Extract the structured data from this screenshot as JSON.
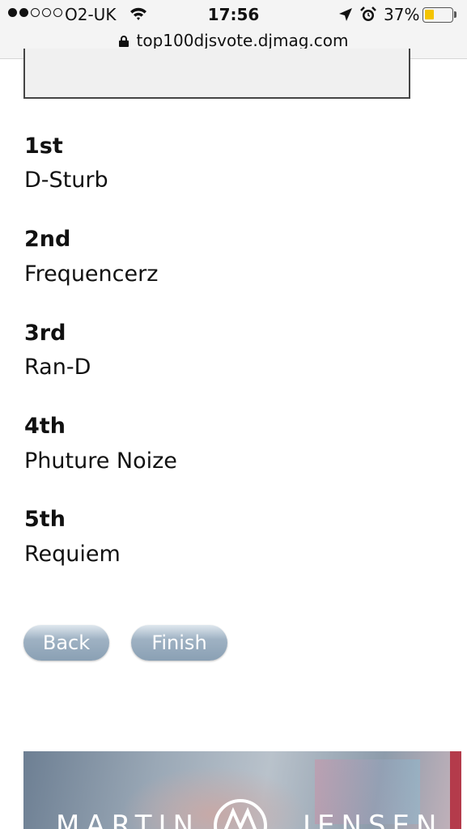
{
  "status_bar": {
    "carrier": "O2-UK",
    "time": "17:56",
    "battery_percent": "37%",
    "battery_level": 0.37,
    "signal_bars_filled": 2,
    "signal_bars_total": 5,
    "icons": [
      "wifi-icon",
      "location-arrow-icon",
      "alarm-icon",
      "battery-icon"
    ]
  },
  "url_bar": {
    "url": "top100djsvote.djmag.com",
    "icon": "lock-icon"
  },
  "votes": [
    {
      "rank": "1st",
      "dj": "D-Sturb"
    },
    {
      "rank": "2nd",
      "dj": "Frequencerz"
    },
    {
      "rank": "3rd",
      "dj": "Ran-D"
    },
    {
      "rank": "4th",
      "dj": "Phuture Noize"
    },
    {
      "rank": "5th",
      "dj": "Requiem"
    }
  ],
  "buttons": {
    "back": "Back",
    "finish": "Finish"
  },
  "banner": {
    "left_text": "MARTIN",
    "right_text": "JENSEN",
    "logo_letter": "M"
  },
  "colors": {
    "button_top": "#dfe7ee",
    "button_bottom": "#8aa0b4",
    "battery": "#f4c400",
    "banner_edge": "#b43b4b"
  }
}
